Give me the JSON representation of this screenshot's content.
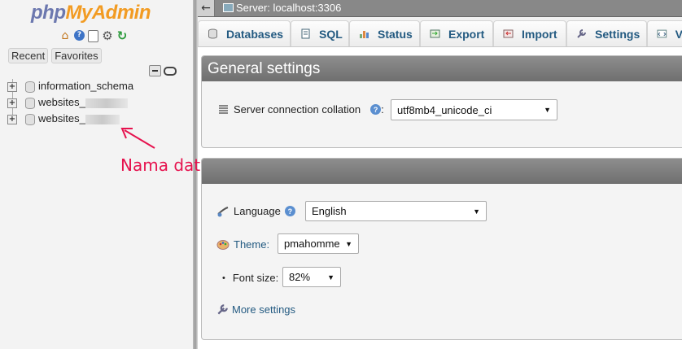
{
  "app": {
    "logo_part1": "php",
    "logo_part2": "MyAdmin"
  },
  "nav": {
    "icons": [
      "home-icon",
      "help-icon",
      "docs-icon",
      "settings-gear-icon",
      "reload-icon"
    ],
    "recent_label": "Recent",
    "favorites_label": "Favorites",
    "databases": [
      {
        "name": "information_schema"
      },
      {
        "name": "websites_"
      },
      {
        "name": "websites_"
      }
    ]
  },
  "annotation": {
    "text": "Nama database WordPress",
    "color": "#e6124e"
  },
  "topbar": {
    "back_label": "←",
    "breadcrumb": "Server: localhost:3306"
  },
  "tabs": [
    {
      "label": "Databases",
      "icon": "database-icon"
    },
    {
      "label": "SQL",
      "icon": "sql-icon"
    },
    {
      "label": "Status",
      "icon": "status-chart-icon"
    },
    {
      "label": "Export",
      "icon": "export-icon"
    },
    {
      "label": "Import",
      "icon": "import-icon"
    },
    {
      "label": "Settings",
      "icon": "wrench-icon"
    },
    {
      "label": "V",
      "icon": "variables-icon"
    }
  ],
  "general_settings": {
    "title": "General settings",
    "collation_label": "Server connection collation",
    "collation_colon": ":",
    "collation_value": "utf8mb4_unicode_ci"
  },
  "appearance_settings": {
    "language_label": "Language",
    "language_value": "English",
    "theme_label": "Theme:",
    "theme_value": "pmahomme",
    "font_size_label": "Font size:",
    "font_size_value": "82%",
    "more_settings_label": "More settings"
  },
  "colors": {
    "link": "#235a81",
    "panel_header": "#7f7f7f",
    "logo_php": "#6c78af",
    "logo_admin": "#f29b22"
  }
}
